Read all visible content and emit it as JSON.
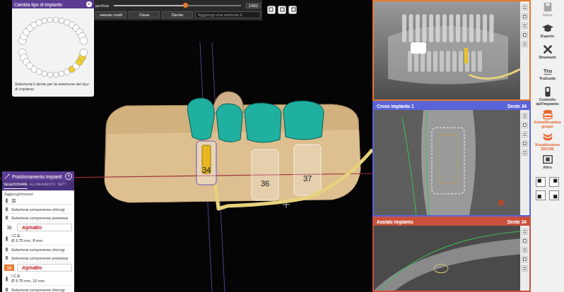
{
  "toolbar": {
    "label": "perficie",
    "value": "1492",
    "level": 0.56,
    "buttons": [
      {
        "label": "essuto molli"
      },
      {
        "label": "Ossa"
      },
      {
        "label": "Dente"
      }
    ],
    "section_field": "Aggiungi una sezione d"
  },
  "implant_type_panel": {
    "title": "Cambia tipo di impianto",
    "close": "×",
    "hint": "Seleziona il dente per la selezione del tipo di impianto",
    "upper_teeth": [
      {
        "selected": false
      },
      {
        "selected": false
      },
      {
        "selected": false
      },
      {
        "selected": false
      },
      {
        "selected": false
      },
      {
        "selected": false
      },
      {
        "selected": false
      },
      {
        "selected": false
      },
      {
        "selected": false
      },
      {
        "selected": false
      },
      {
        "selected": false
      },
      {
        "selected": false
      },
      {
        "selected": false
      },
      {
        "selected": false
      },
      {
        "selected": false
      },
      {
        "selected": false
      }
    ],
    "lower_teeth": [
      {
        "selected": false
      },
      {
        "selected": false
      },
      {
        "selected": false
      },
      {
        "selected": false
      },
      {
        "selected": false
      },
      {
        "selected": false
      },
      {
        "selected": false
      },
      {
        "selected": false
      },
      {
        "selected": false
      },
      {
        "selected": false
      },
      {
        "selected": false
      },
      {
        "selected": true
      },
      {
        "selected": false
      },
      {
        "selected": true
      },
      {
        "selected": true
      },
      {
        "selected": false
      }
    ]
  },
  "scene": {
    "implants": [
      {
        "label": "34",
        "selected": true
      },
      {
        "label": "36",
        "selected": false
      },
      {
        "label": "37",
        "selected": false
      }
    ]
  },
  "positioning_panel": {
    "title": "Posizionamento impianti",
    "help": "?",
    "tabs": [
      {
        "label": "SELEZIONARE",
        "selected": true
      },
      {
        "label": "ALLINEAMENTO",
        "selected": false
      },
      {
        "label": "SETT",
        "selected": false
      }
    ],
    "add_remove": "Aggiungi/rimuovi",
    "entries": [
      {
        "kind": "component",
        "label": "Seleziona componente chirurgi"
      },
      {
        "kind": "component",
        "label": "Seleziona componente protesica"
      },
      {
        "kind": "implant",
        "tooth": "36",
        "brand": "AlphaBio",
        "product": "I.C.E.",
        "spec": "Ø 3.75 mm, 8 mm",
        "selected": false
      },
      {
        "kind": "component",
        "label": "Seleziona componente chirurgi"
      },
      {
        "kind": "component",
        "label": "Seleziona componente protesica"
      },
      {
        "kind": "implant",
        "tooth": "34",
        "brand": "AlphaBio",
        "product": "I.C.E.",
        "spec": "Ø 3.75 mm, 10 mm",
        "selected": true
      },
      {
        "kind": "component",
        "label": "Seleziona componente chirurgi"
      }
    ]
  },
  "views": [
    {
      "kind": "panoramic",
      "title": "",
      "tooth": "",
      "color": "#e8782c"
    },
    {
      "kind": "cross",
      "title": "Cross impianto 1",
      "tooth": "Dente 34",
      "color": "#5a63d8"
    },
    {
      "kind": "axial",
      "title": "Assiale impianto",
      "tooth": "Dente 34",
      "color": "#c9513d"
    }
  ],
  "sidebar": {
    "items": [
      {
        "label": "Salva",
        "disabled": true,
        "active": false
      },
      {
        "label": "Esperto",
        "disabled": false,
        "active": false
      },
      {
        "label": "Strumenti",
        "disabled": false,
        "active": false
      },
      {
        "label": "TruGuide",
        "disabled": false,
        "active": false,
        "badge": "Tru"
      },
      {
        "label": "Controllo dell'impianto",
        "disabled": false,
        "active": false
      },
      {
        "label": "Attiva/Disattiva gruppi",
        "disabled": false,
        "active": true
      },
      {
        "label": "Visualizzatore DICOM",
        "disabled": false,
        "active": true
      },
      {
        "label": "Altro",
        "disabled": false,
        "active": false
      }
    ]
  }
}
